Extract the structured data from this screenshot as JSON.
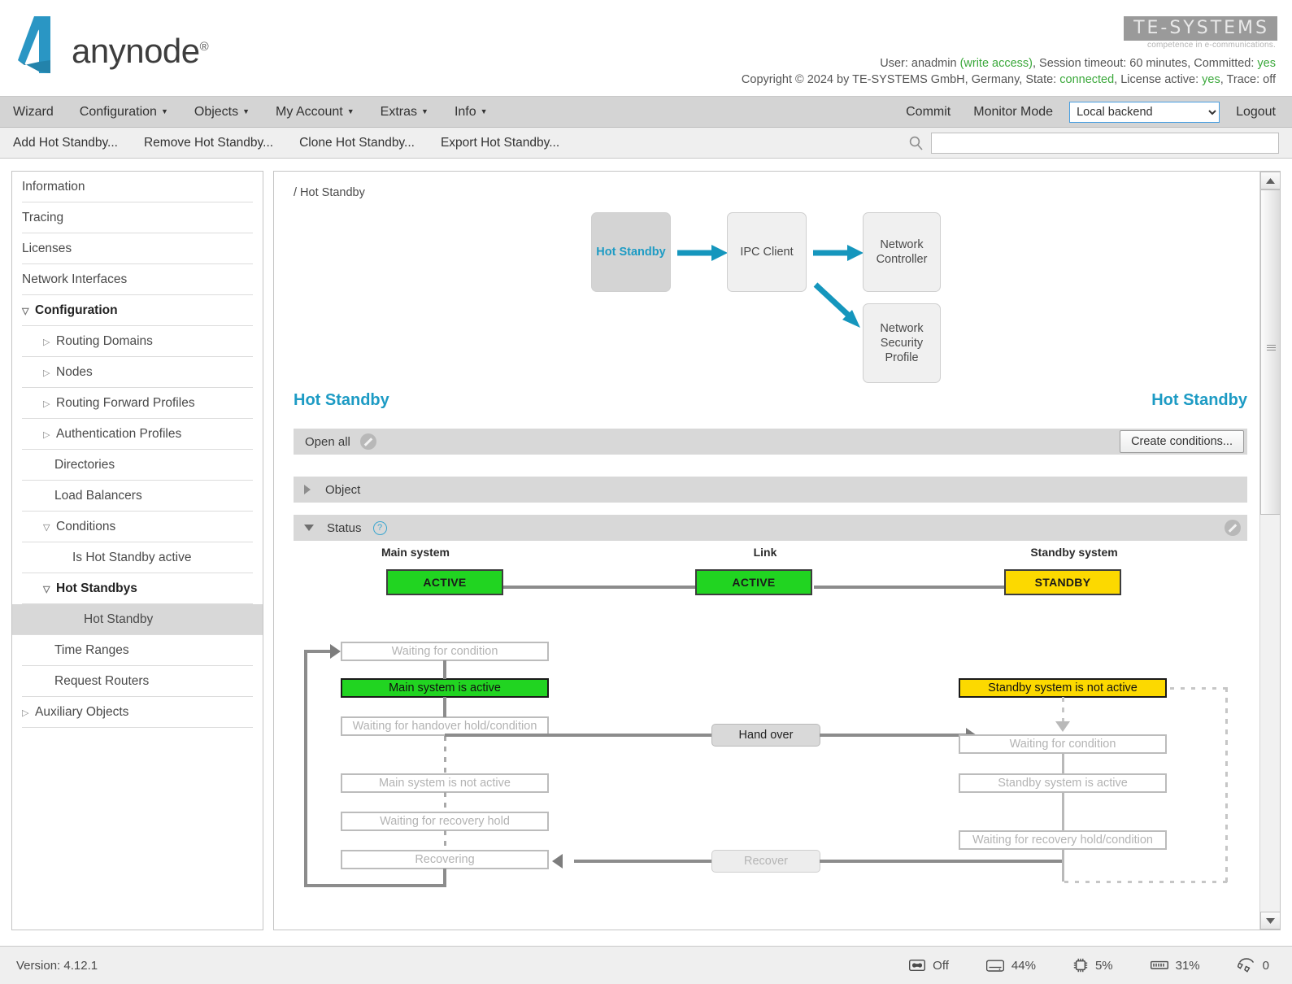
{
  "brand": {
    "product": "anynode",
    "registered": "®",
    "company": "TE-SYSTEMS",
    "tagline": "competence in e-communications."
  },
  "header": {
    "line1_prefix": "User: anadmin ",
    "line1_write": "(write access)",
    "line1_mid": ", Session timeout: 60 minutes, Committed: ",
    "line1_committed": "yes",
    "line2_prefix": "Copyright © 2024 by TE-SYSTEMS GmbH, Germany, State: ",
    "line2_state": "connected",
    "line2_mid": ", License active: ",
    "line2_license": "yes",
    "line2_suffix": ", Trace: off"
  },
  "menu": {
    "items": [
      {
        "label": "Wizard",
        "caret": false
      },
      {
        "label": "Configuration",
        "caret": true
      },
      {
        "label": "Objects",
        "caret": true
      },
      {
        "label": "My Account",
        "caret": true
      },
      {
        "label": "Extras",
        "caret": true
      },
      {
        "label": "Info",
        "caret": true
      }
    ],
    "commit": "Commit",
    "monitor": "Monitor Mode",
    "backend_selected": "Local backend",
    "backend_options": [
      "Local backend"
    ],
    "logout": "Logout"
  },
  "actionbar": {
    "items": [
      "Add Hot Standby...",
      "Remove Hot Standby...",
      "Clone Hot Standby...",
      "Export Hot Standby..."
    ],
    "search_value": "",
    "search_placeholder": ""
  },
  "sidebar": {
    "items": [
      {
        "label": "Information",
        "indent": 0,
        "twisty": "none",
        "state": "normal"
      },
      {
        "label": "Tracing",
        "indent": 0,
        "twisty": "none",
        "state": "normal"
      },
      {
        "label": "Licenses",
        "indent": 0,
        "twisty": "none",
        "state": "normal"
      },
      {
        "label": "Network Interfaces",
        "indent": 0,
        "twisty": "none",
        "state": "normal"
      },
      {
        "label": "Configuration",
        "indent": 0,
        "twisty": "open",
        "state": "bold"
      },
      {
        "label": "Routing Domains",
        "indent": 1,
        "twisty": "closed",
        "state": "normal"
      },
      {
        "label": "Nodes",
        "indent": 1,
        "twisty": "closed",
        "state": "normal"
      },
      {
        "label": "Routing Forward Profiles",
        "indent": 1,
        "twisty": "closed",
        "state": "normal"
      },
      {
        "label": "Authentication Profiles",
        "indent": 1,
        "twisty": "closed",
        "state": "normal"
      },
      {
        "label": "Directories",
        "indent": 2,
        "twisty": "none",
        "state": "normal"
      },
      {
        "label": "Load Balancers",
        "indent": 2,
        "twisty": "none",
        "state": "normal"
      },
      {
        "label": "Conditions",
        "indent": 1,
        "twisty": "open",
        "state": "normal"
      },
      {
        "label": "Is Hot Standby active",
        "indent": 3,
        "twisty": "none",
        "state": "normal"
      },
      {
        "label": "Hot Standbys",
        "indent": 1,
        "twisty": "open",
        "state": "bold"
      },
      {
        "label": "Hot Standby",
        "indent": 3,
        "twisty": "none",
        "state": "selected"
      },
      {
        "label": "Time Ranges",
        "indent": 2,
        "twisty": "none",
        "state": "normal"
      },
      {
        "label": "Request Routers",
        "indent": 2,
        "twisty": "none",
        "state": "normal"
      },
      {
        "label": "Auxiliary Objects",
        "indent": 0,
        "twisty": "closed",
        "state": "normal"
      }
    ]
  },
  "main": {
    "breadcrumb": "/ Hot Standby",
    "chain": {
      "boxes": [
        {
          "label": "Hot Standby",
          "current": true
        },
        {
          "label": "IPC Client",
          "current": false
        },
        {
          "label": "Network\nController",
          "current": false
        },
        {
          "label": "Network\nSecurity\nProfile",
          "current": false
        }
      ]
    },
    "title_left": "Hot Standby",
    "title_right": "Hot Standby",
    "toolbar": {
      "open_all": "Open all",
      "create_conditions": "Create conditions..."
    },
    "sections": [
      {
        "label": "Object",
        "expanded": false
      },
      {
        "label": "Status",
        "expanded": true
      }
    ]
  },
  "status_diagram": {
    "columns": [
      {
        "label": "Main system",
        "value": "ACTIVE",
        "color": "green"
      },
      {
        "label": "Link",
        "value": "ACTIVE",
        "color": "green"
      },
      {
        "label": "Standby system",
        "value": "STANDBY",
        "color": "yellow"
      }
    ],
    "main_states": [
      {
        "label": "Waiting for condition",
        "active": false
      },
      {
        "label": "Main system is active",
        "active": true,
        "color": "green"
      },
      {
        "label": "Waiting for handover hold/condition",
        "active": false
      },
      {
        "label": "Main system is not active",
        "active": false
      },
      {
        "label": "Waiting for recovery hold",
        "active": false
      },
      {
        "label": "Recovering",
        "active": false
      }
    ],
    "standby_states": [
      {
        "label": "Standby system is not active",
        "active": true,
        "color": "yellow"
      },
      {
        "label": "Waiting for condition",
        "active": false
      },
      {
        "label": "Standby system is active",
        "active": false
      },
      {
        "label": "Waiting for recovery hold/condition",
        "active": false
      }
    ],
    "transitions": [
      {
        "label": "Hand over",
        "active": true
      },
      {
        "label": "Recover",
        "active": false
      }
    ]
  },
  "footer": {
    "version_label": "Version:",
    "version_value": "4.12.1",
    "stats": [
      {
        "icon": "tape-icon",
        "value": "Off"
      },
      {
        "icon": "disk-icon",
        "value": "44%"
      },
      {
        "icon": "cpu-icon",
        "value": "5%"
      },
      {
        "icon": "ram-icon",
        "value": "31%"
      },
      {
        "icon": "calls-icon",
        "value": "0"
      }
    ]
  },
  "colors": {
    "accent": "#1d9bc4",
    "active_green": "#21d421",
    "standby_yellow": "#fcd900",
    "status_green_text": "#3ba83b"
  }
}
